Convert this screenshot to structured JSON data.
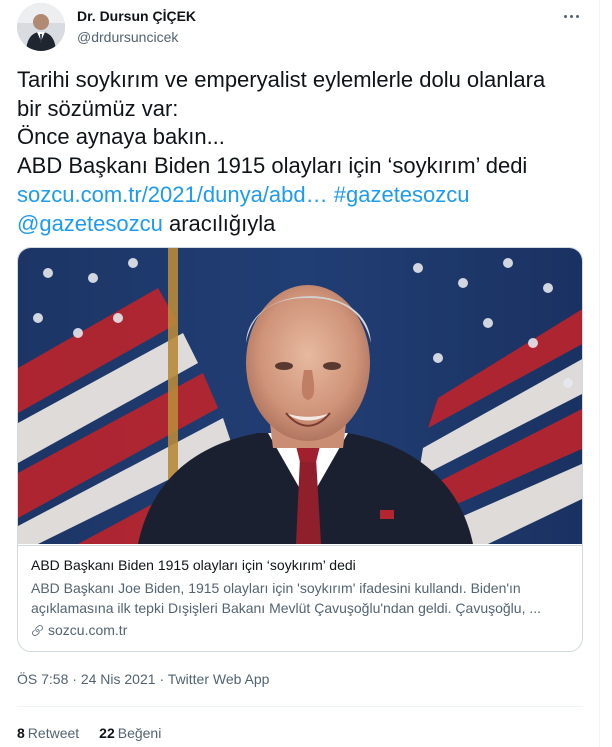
{
  "author": {
    "name": "Dr. Dursun ÇİÇEK",
    "handle": "@drdursuncicek"
  },
  "tweet": {
    "line1": "Tarihi soykırım ve emperyalist eylemlerle dolu olanlara",
    "line2": "bir sözümüz var:",
    "line3": "Önce aynaya bakın...",
    "line4": "ABD Başkanı Biden 1915 olayları için ‘soykırım’ dedi",
    "link_url": "sozcu.com.tr/2021/dunya/abd…",
    "hashtag": "#gazetesozcu",
    "mention": "@gazetesozcu",
    "via_text": "aracılığıyla"
  },
  "card": {
    "title": "ABD Başkanı Biden 1915 olayları için ‘soykırım’ dedi",
    "description": "ABD Başkanı Joe Biden, 1915 olayları için 'soykırım' ifadesini kullandı. Biden'ın açıklamasına ilk tepki Dışişleri Bakanı Mevlüt Çavuşoğlu'ndan geldi. Çavuşoğlu, ...",
    "source": "sozcu.com.tr"
  },
  "meta": {
    "time": "ÖS 7:58",
    "date": "24 Nis 2021",
    "client": "Twitter Web App",
    "separator": "·"
  },
  "stats": {
    "retweet_count": "8",
    "retweet_label": "Retweet",
    "like_count": "22",
    "like_label": "Beğeni"
  },
  "colors": {
    "link": "#1d9bf0",
    "text": "#0f1419",
    "secondary": "#536471",
    "border": "#cfd9de"
  },
  "icons": {
    "more": "more-horizontal-icon",
    "source": "link-icon"
  }
}
